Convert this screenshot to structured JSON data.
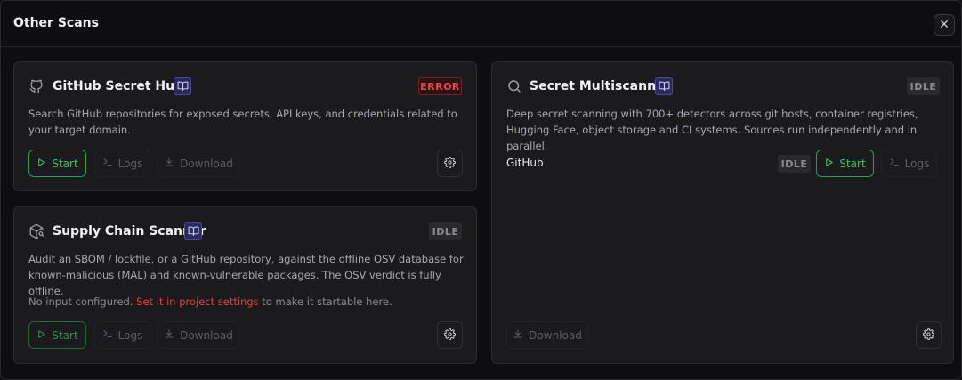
{
  "modal": {
    "title": "Other Scans",
    "close_symbol": "✕"
  },
  "cards": {
    "github_secret_hunt": {
      "title": "GitHub Secret Hunt",
      "icon": "github-icon",
      "status": "ERROR",
      "description": "Search GitHub repositories for exposed secrets, API keys, and credentials related to your target domain.",
      "start_label": "Start",
      "logs_label": "Logs",
      "download_label": "Download"
    },
    "supply_chain_scanner": {
      "title": "Supply Chain Scanner",
      "icon": "package-search-icon",
      "status": "IDLE",
      "description": "Audit an SBOM / lockfile, or a GitHub repository, against the offline OSV database for known-malicious (MAL) and known-vulnerable packages. The OSV verdict is fully offline.",
      "note_prefix": "No input configured.",
      "note_link": "Set it in project settings",
      "note_suffix": "to make it startable here.",
      "start_label": "Start",
      "logs_label": "Logs",
      "download_label": "Download"
    },
    "secret_multiscanner": {
      "title": "Secret Multiscanner",
      "icon": "search-icon",
      "status": "IDLE",
      "description": "Deep secret scanning with 700+ detectors across git hosts, container registries, Hugging Face, object storage and CI systems. Sources run independently and in parallel.",
      "source": {
        "name": "GitHub",
        "status": "IDLE",
        "start_label": "Start",
        "logs_label": "Logs"
      },
      "download_label": "Download"
    }
  },
  "colors": {
    "accent_green": "#22a34e",
    "error_red": "#ef4444",
    "link_red": "#e0413c",
    "doc_badge": "#4a4aa0"
  }
}
